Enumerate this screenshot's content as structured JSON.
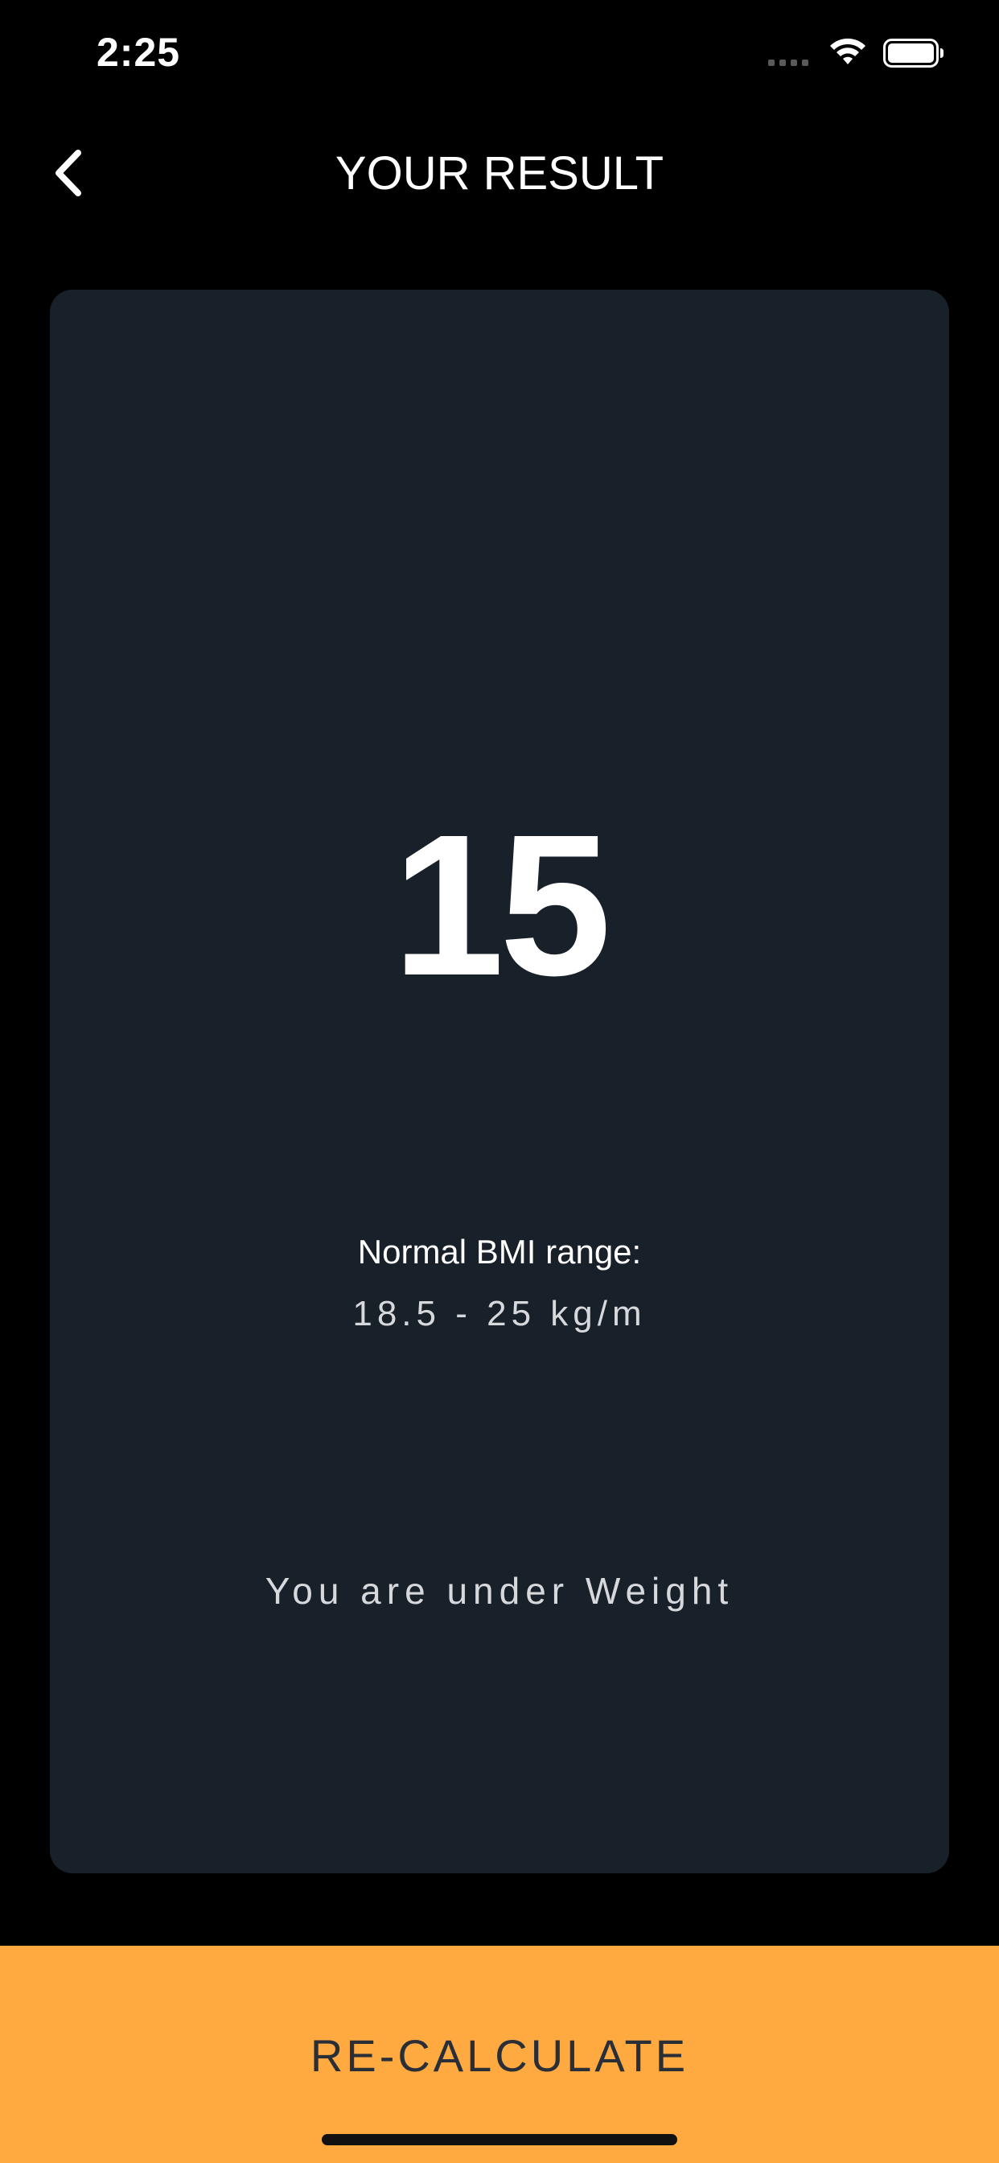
{
  "status_bar": {
    "time": "2:25",
    "icons": [
      "cellular-signal-icon",
      "wifi-icon",
      "battery-icon"
    ]
  },
  "nav": {
    "back_icon": "chevron-left-icon",
    "title": "YOUR RESULT"
  },
  "result": {
    "bmi_value": "15",
    "range_label": "Normal BMI range:",
    "range_value": "18.5 - 25 kg/m",
    "message": "You are under Weight"
  },
  "action": {
    "recalculate_label": "RE-CALCULATE"
  },
  "colors": {
    "background": "#000000",
    "card": "#18202a",
    "accent": "#ffaa41",
    "text_primary": "#ffffff",
    "text_secondary": "#d6d8dc",
    "button_text": "#2a2e36"
  }
}
